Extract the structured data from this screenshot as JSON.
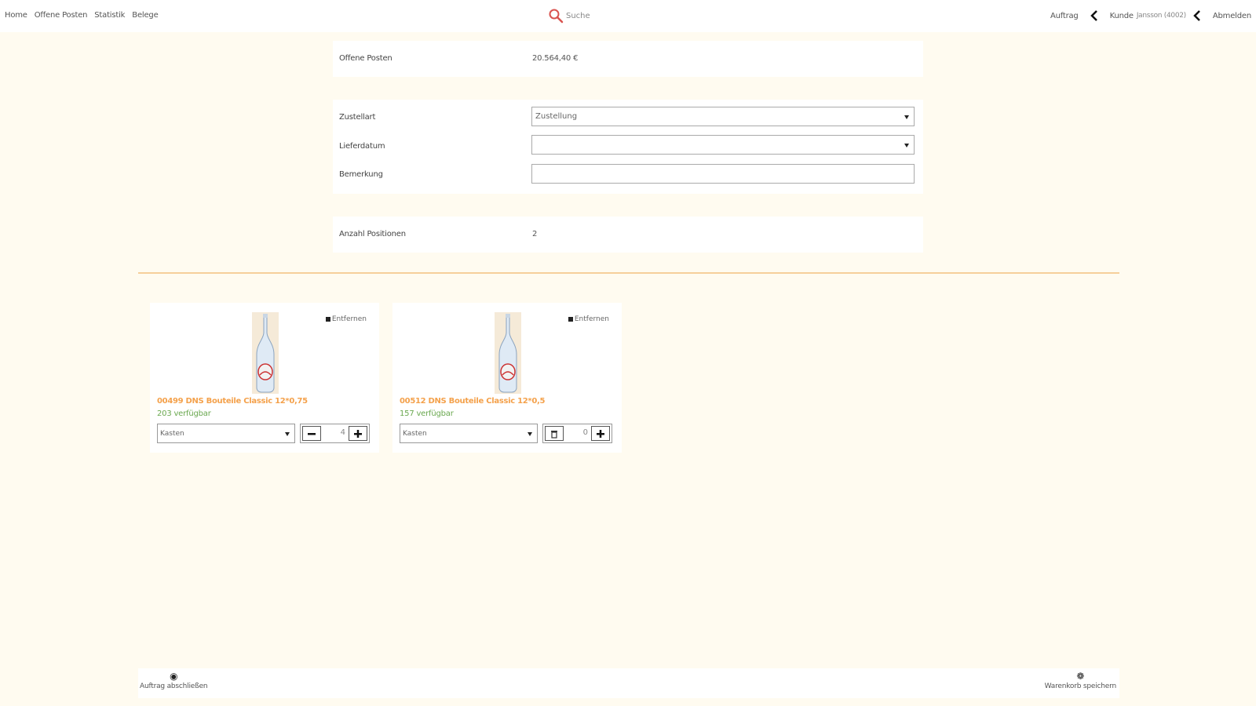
{
  "nav": {
    "links": [
      "Home",
      "Offene Posten",
      "Statistik",
      "Belege"
    ],
    "search_label": "Suche",
    "order_label": "Auftrag",
    "customer_label": "Kunde",
    "customer_value": "Jansson (4002)",
    "logout_label": "Abmelden"
  },
  "summary": {
    "open_items_label": "Offene Posten",
    "open_items_value": "20.564,40 €"
  },
  "order_form": {
    "delivery_type_label": "Zustellart",
    "delivery_type_value": "Zustellung",
    "delivery_date_label": "Lieferdatum",
    "delivery_date_value": "",
    "remark_label": "Bemerkung",
    "remark_value": ""
  },
  "positions": {
    "count_label": "Anzahl Positionen",
    "count_value": "2"
  },
  "products": [
    {
      "name": "00499 DNS Bouteile Classic 12*0,75",
      "availability": "203 verfügbar",
      "unit": "Kasten",
      "quantity": "4",
      "remove_label": "Entfernen"
    },
    {
      "name": "00512 DNS Bouteile Classic 12*0,5",
      "availability": "157 verfügbar",
      "unit": "Kasten",
      "quantity": "0",
      "remove_label": "Entfernen"
    }
  ],
  "footer": {
    "close_order_label": "Auftrag abschließen",
    "save_cart_label": "Warenkorb speichern"
  },
  "colors": {
    "background": "#fffbf0",
    "product_name": "#f4a14b",
    "availability": "#6aa84f",
    "divider": "#f6cf9a",
    "search_icon": "#d9534f"
  }
}
